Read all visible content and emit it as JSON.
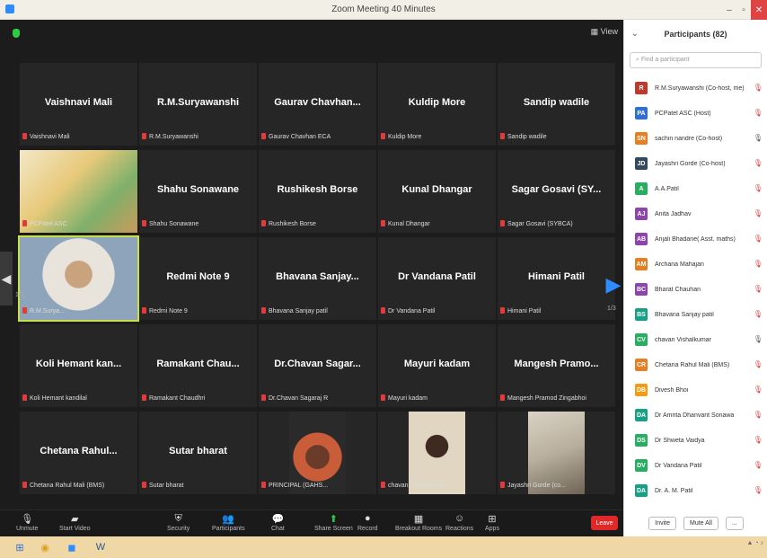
{
  "window": {
    "title": "Zoom Meeting 40 Minutes"
  },
  "meeting": {
    "view_label": "View",
    "page_left": "1/3",
    "page_right": "1/3",
    "tiles": [
      {
        "name": "Vaishnavi Mali",
        "label": "Vaishnavi Mali"
      },
      {
        "name": "R.M.Suryawanshi",
        "label": "R.M.Suryawanshi"
      },
      {
        "name": "Gaurav  Chavhan...",
        "label": "Gaurav Chavhan ECA"
      },
      {
        "name": "Kuldip More",
        "label": "Kuldip More"
      },
      {
        "name": "Sandip wadile",
        "label": "Sandip wadile"
      },
      {
        "name": "",
        "label": "PCPatel ASC"
      },
      {
        "name": "Shahu Sonawane",
        "label": "Shahu Sonawane"
      },
      {
        "name": "Rushikesh Borse",
        "label": "Rushikesh Borse"
      },
      {
        "name": "Kunal Dhangar",
        "label": "Kunal Dhangar"
      },
      {
        "name": "Sagar Gosavi (SY...",
        "label": "Sagar Gosavi (SYBCA)"
      },
      {
        "name": "",
        "label": "R.M.Surya..."
      },
      {
        "name": "Redmi Note 9",
        "label": "Redmi Note 9"
      },
      {
        "name": "Bhavana  Sanjay...",
        "label": "Bhavana Sanjay patil"
      },
      {
        "name": "Dr Vandana Patil",
        "label": "Dr Vandana Patil"
      },
      {
        "name": "Himani Patil",
        "label": "Himani Patil"
      },
      {
        "name": "Koli Hemant  kan...",
        "label": "Koli Hemant kandilal"
      },
      {
        "name": "Ramakant  Chau...",
        "label": "Ramakant Chaudhri"
      },
      {
        "name": "Dr.Chavan  Sagar...",
        "label": "Dr.Chavan Sagaraj R"
      },
      {
        "name": "Mayuri kadam",
        "label": "Mayuri kadam"
      },
      {
        "name": "Mangesh  Pramo...",
        "label": "Mangesh Pramod Zingabhoi"
      },
      {
        "name": "Chetana  Rahul...",
        "label": "Chetana Rahul Mali (BMS)"
      },
      {
        "name": "Sutar bharat",
        "label": "Sutar bharat"
      },
      {
        "name": "",
        "label": "PRINCIPAL (GAHS..."
      },
      {
        "name": "",
        "label": "chavan Vishalkumar"
      },
      {
        "name": "",
        "label": "Jayashri Gorde (co..."
      }
    ]
  },
  "toolbar": {
    "items": [
      {
        "label": "Unmute",
        "icon": "mic-muted-icon"
      },
      {
        "label": "Start Video",
        "icon": "video-off-icon"
      },
      {
        "label": "Security",
        "icon": "shield-icon"
      },
      {
        "label": "Participants",
        "icon": "participants-icon",
        "count": "82"
      },
      {
        "label": "Chat",
        "icon": "chat-icon"
      },
      {
        "label": "Share Screen",
        "icon": "share-screen-icon"
      },
      {
        "label": "Record",
        "icon": "record-icon"
      },
      {
        "label": "Breakout Rooms",
        "icon": "breakout-icon"
      },
      {
        "label": "Reactions",
        "icon": "reactions-icon"
      },
      {
        "label": "Apps",
        "icon": "apps-icon"
      }
    ],
    "leave_label": "Leave"
  },
  "panel": {
    "title": "Participants (82)",
    "search_placeholder": "Find a participant",
    "participants": [
      {
        "initial": "R",
        "color": "#c0392b",
        "name": "R.M.Suryawanshi (Co-host, me)",
        "mic": "muted"
      },
      {
        "initial": "PA",
        "color": "#2d6fd6",
        "name": "PCPatel ASC (Host)",
        "mic": "muted"
      },
      {
        "initial": "SN",
        "color": "#e67e22",
        "name": "sachin nandre (Co-host)",
        "mic": "on"
      },
      {
        "initial": "JD",
        "color": "#34495e",
        "name": "Jayashri Gorde (Co-host)",
        "mic": "muted"
      },
      {
        "initial": "A",
        "color": "#27ae60",
        "name": "A.A.Patil",
        "mic": "muted"
      },
      {
        "initial": "AJ",
        "color": "#8e44ad",
        "name": "Anita Jadhav",
        "mic": "muted"
      },
      {
        "initial": "AB",
        "color": "#8e44ad",
        "name": "Anjali Bhadane( Asst. maths)",
        "mic": "muted"
      },
      {
        "initial": "AM",
        "color": "#e67e22",
        "name": "Archana Mahajan",
        "mic": "muted"
      },
      {
        "initial": "BC",
        "color": "#8e44ad",
        "name": "Bharat Chauhan",
        "mic": "muted"
      },
      {
        "initial": "BS",
        "color": "#16a085",
        "name": "Bhavana Sanjay patil",
        "mic": "muted"
      },
      {
        "initial": "CV",
        "color": "#27ae60",
        "name": "chavan Vishalkumar",
        "mic": "on"
      },
      {
        "initial": "CR",
        "color": "#e67e22",
        "name": "Chetana Rahul Mali (BMS)",
        "mic": "muted"
      },
      {
        "initial": "DB",
        "color": "#f39c12",
        "name": "Divesh Bhoi",
        "mic": "muted"
      },
      {
        "initial": "DA",
        "color": "#16a085",
        "name": "Dr Amrita Dhanvant Sonawa",
        "mic": "muted"
      },
      {
        "initial": "DS",
        "color": "#27ae60",
        "name": "Dr Shweta Vaidya",
        "mic": "muted"
      },
      {
        "initial": "DV",
        "color": "#27ae60",
        "name": "Dr Vandana Patil",
        "mic": "muted"
      },
      {
        "initial": "DA",
        "color": "#16a085",
        "name": "Dr. A. M. Patil",
        "mic": "muted"
      }
    ],
    "invite_label": "Invite",
    "mute_all_label": "Mute All",
    "more_label": "..."
  },
  "taskbar": {
    "apps": [
      {
        "icon": "windows-start-icon"
      },
      {
        "icon": "chrome-icon"
      },
      {
        "icon": "zoom-icon"
      },
      {
        "icon": "word-icon"
      }
    ]
  }
}
